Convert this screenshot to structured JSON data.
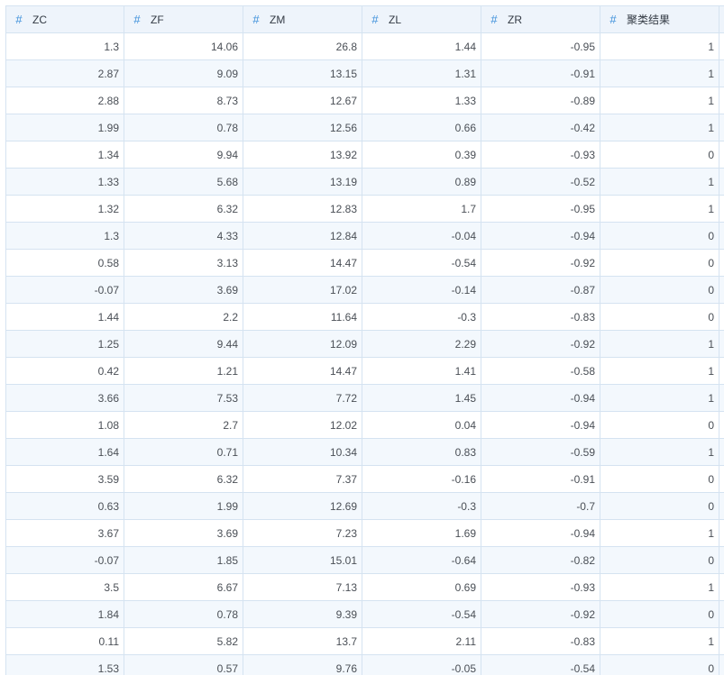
{
  "table": {
    "columns": [
      {
        "type_icon": "#",
        "label": "ZC"
      },
      {
        "type_icon": "#",
        "label": "ZF"
      },
      {
        "type_icon": "#",
        "label": "ZM"
      },
      {
        "type_icon": "#",
        "label": "ZL"
      },
      {
        "type_icon": "#",
        "label": "ZR"
      },
      {
        "type_icon": "#",
        "label": "聚类结果"
      }
    ],
    "rows": [
      [
        "1.3",
        "14.06",
        "26.8",
        "1.44",
        "-0.95",
        "1"
      ],
      [
        "2.87",
        "9.09",
        "13.15",
        "1.31",
        "-0.91",
        "1"
      ],
      [
        "2.88",
        "8.73",
        "12.67",
        "1.33",
        "-0.89",
        "1"
      ],
      [
        "1.99",
        "0.78",
        "12.56",
        "0.66",
        "-0.42",
        "1"
      ],
      [
        "1.34",
        "9.94",
        "13.92",
        "0.39",
        "-0.93",
        "0"
      ],
      [
        "1.33",
        "5.68",
        "13.19",
        "0.89",
        "-0.52",
        "1"
      ],
      [
        "1.32",
        "6.32",
        "12.83",
        "1.7",
        "-0.95",
        "1"
      ],
      [
        "1.3",
        "4.33",
        "12.84",
        "-0.04",
        "-0.94",
        "0"
      ],
      [
        "0.58",
        "3.13",
        "14.47",
        "-0.54",
        "-0.92",
        "0"
      ],
      [
        "-0.07",
        "3.69",
        "17.02",
        "-0.14",
        "-0.87",
        "0"
      ],
      [
        "1.44",
        "2.2",
        "11.64",
        "-0.3",
        "-0.83",
        "0"
      ],
      [
        "1.25",
        "9.44",
        "12.09",
        "2.29",
        "-0.92",
        "1"
      ],
      [
        "0.42",
        "1.21",
        "14.47",
        "1.41",
        "-0.58",
        "1"
      ],
      [
        "3.66",
        "7.53",
        "7.72",
        "1.45",
        "-0.94",
        "1"
      ],
      [
        "1.08",
        "2.7",
        "12.02",
        "0.04",
        "-0.94",
        "0"
      ],
      [
        "1.64",
        "0.71",
        "10.34",
        "0.83",
        "-0.59",
        "1"
      ],
      [
        "3.59",
        "6.32",
        "7.37",
        "-0.16",
        "-0.91",
        "0"
      ],
      [
        "0.63",
        "1.99",
        "12.69",
        "-0.3",
        "-0.7",
        "0"
      ],
      [
        "3.67",
        "3.69",
        "7.23",
        "1.69",
        "-0.94",
        "1"
      ],
      [
        "-0.07",
        "1.85",
        "15.01",
        "-0.64",
        "-0.82",
        "0"
      ],
      [
        "3.5",
        "6.67",
        "7.13",
        "0.69",
        "-0.93",
        "1"
      ],
      [
        "1.84",
        "0.78",
        "9.39",
        "-0.54",
        "-0.92",
        "0"
      ],
      [
        "0.11",
        "5.82",
        "13.7",
        "2.11",
        "-0.83",
        "1"
      ],
      [
        "1.53",
        "0.57",
        "9.76",
        "-0.05",
        "-0.54",
        "0"
      ]
    ]
  }
}
